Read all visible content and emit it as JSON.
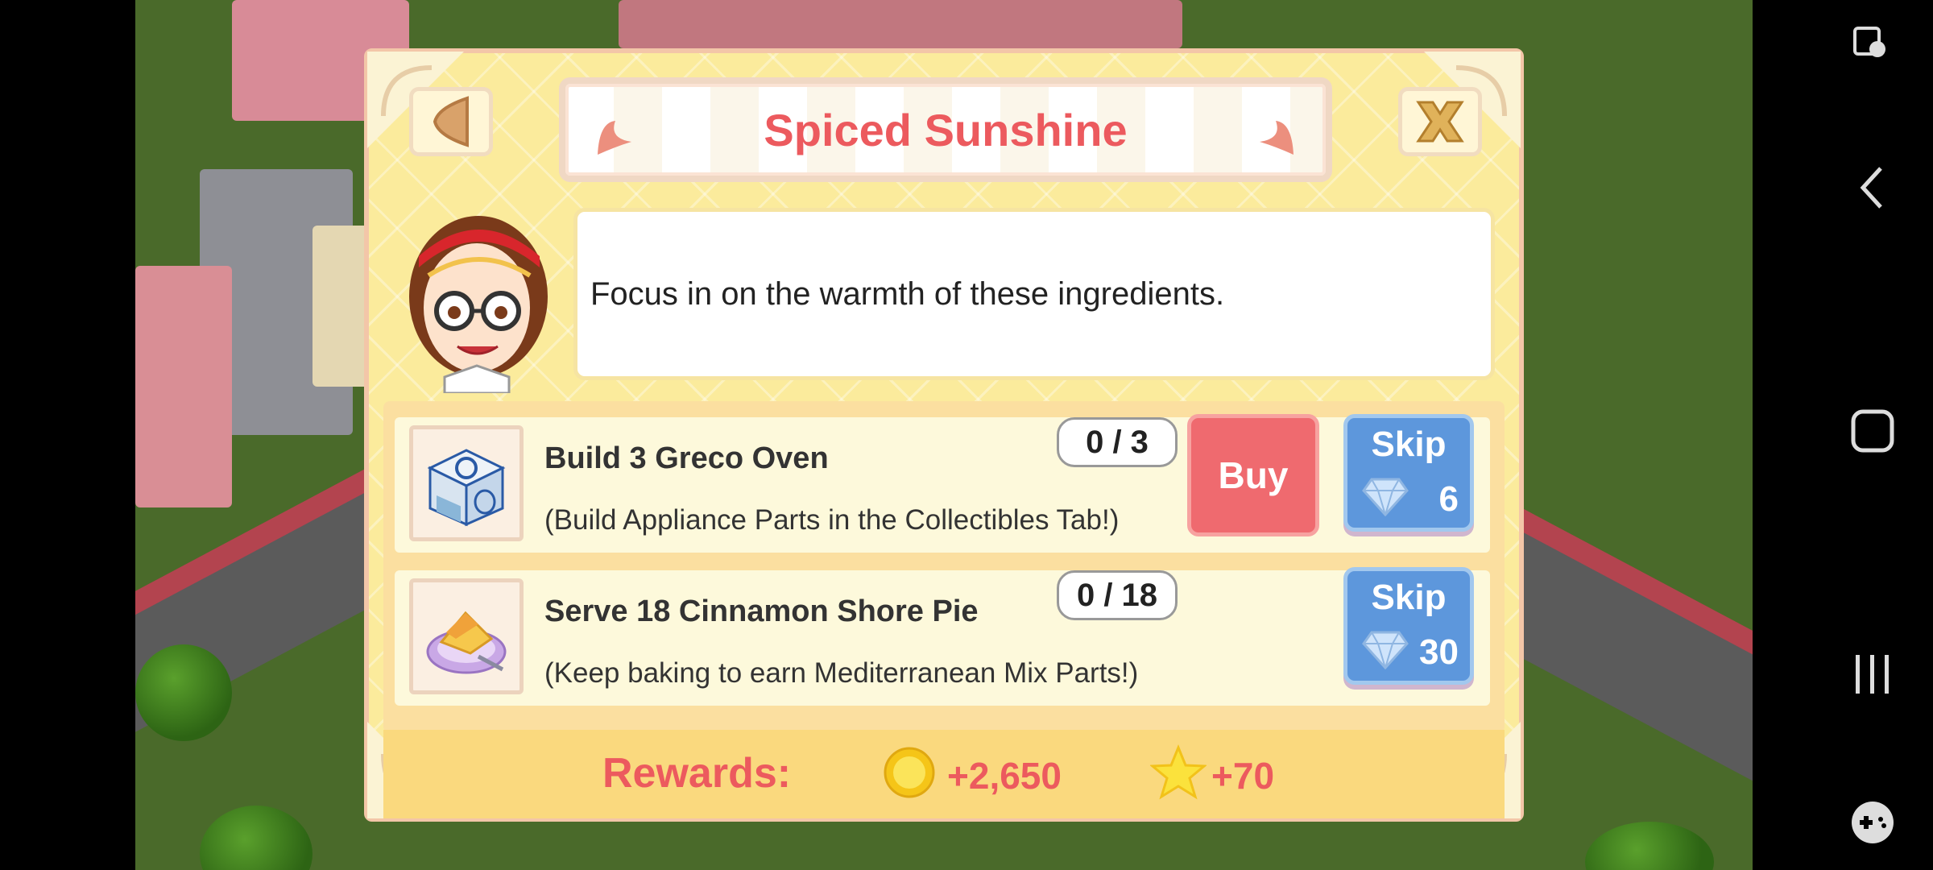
{
  "dialog": {
    "title": "Spiced Sunshine",
    "message": "Focus in on the warmth of these ingredients.",
    "back_icon": "back-arrow-icon",
    "close_icon": "close-x-icon"
  },
  "tasks": [
    {
      "title": "Build 3 Greco Oven",
      "subtitle": "(Build Appliance Parts in the Collectibles Tab!)",
      "progress": "0 / 3",
      "buy_label": "Buy",
      "skip_label": "Skip",
      "skip_cost": "6",
      "icon": "oven-icon"
    },
    {
      "title": "Serve 18 Cinnamon Shore Pie",
      "subtitle": "(Keep baking to earn Mediterranean Mix Parts!)",
      "progress": "0 / 18",
      "skip_label": "Skip",
      "skip_cost": "30",
      "icon": "pie-icon"
    }
  ],
  "rewards": {
    "label": "Rewards:",
    "coins": "+2,650",
    "stars": "+70"
  },
  "colors": {
    "accent": "#ec5a5e",
    "skip_blue": "#5d97dc",
    "buy_red": "#ef6a6f",
    "panel_yellow": "#fbeb9c"
  },
  "system_nav": {
    "icons": [
      "accessibility-icon",
      "back-nav-icon",
      "home-nav-icon",
      "recents-nav-icon",
      "game-controller-icon"
    ]
  }
}
